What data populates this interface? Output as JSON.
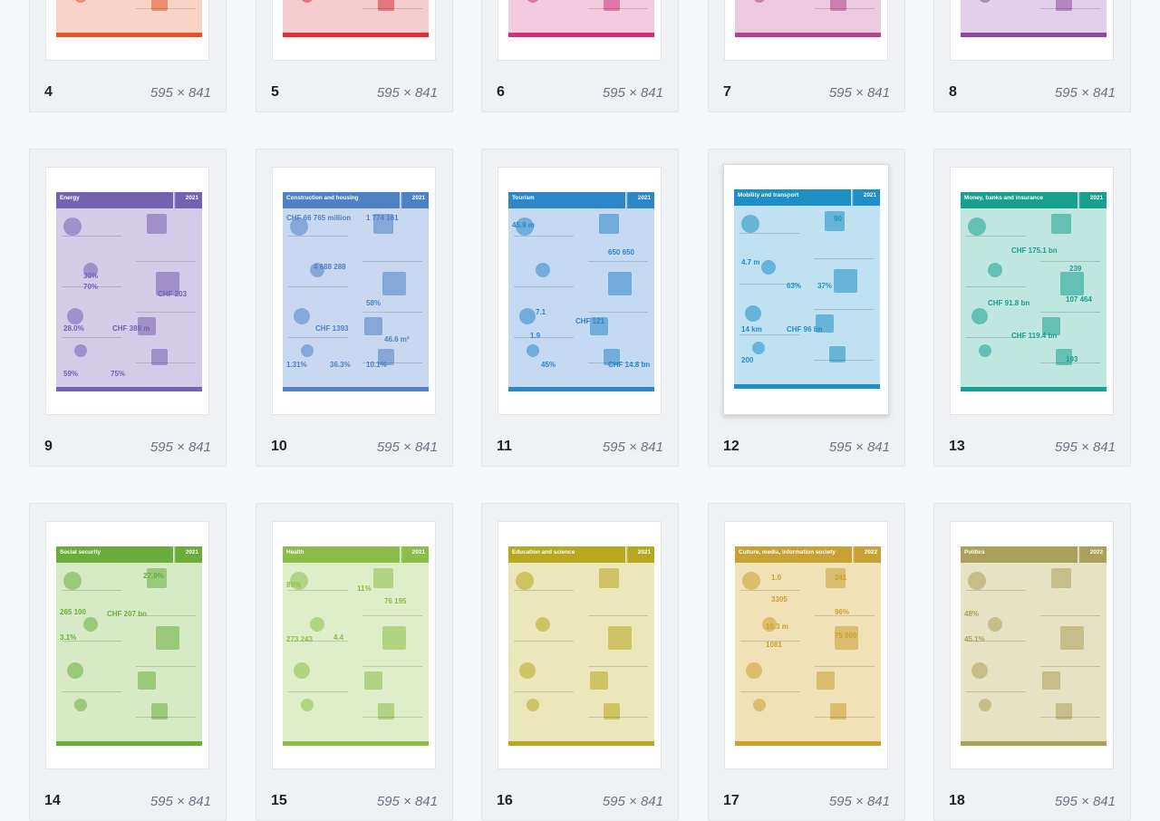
{
  "pages": [
    {
      "num": "4",
      "dims": "595 × 841",
      "theme": "#e4562a",
      "bg": "#f7d4c6",
      "title": "",
      "year": ""
    },
    {
      "num": "5",
      "dims": "595 × 841",
      "theme": "#dd2e3a",
      "bg": "#f4cdd0",
      "title": "",
      "year": ""
    },
    {
      "num": "6",
      "dims": "595 × 841",
      "theme": "#d0327a",
      "bg": "#f3cade",
      "title": "",
      "year": ""
    },
    {
      "num": "7",
      "dims": "595 × 841",
      "theme": "#b2448c",
      "bg": "#eccbe0",
      "title": "",
      "year": ""
    },
    {
      "num": "8",
      "dims": "595 × 841",
      "theme": "#8a4a9c",
      "bg": "#e2d0ea",
      "title": "",
      "year": ""
    },
    {
      "num": "9",
      "dims": "595 × 841",
      "theme": "#7461b0",
      "bg": "#d3cbe8",
      "title": "Energy",
      "year": "2021"
    },
    {
      "num": "10",
      "dims": "595 × 841",
      "theme": "#4f81c4",
      "bg": "#c7d8f0",
      "title": "Construction and housing",
      "year": "2021"
    },
    {
      "num": "11",
      "dims": "595 × 841",
      "theme": "#2d86c8",
      "bg": "#c3daf2",
      "title": "Tourism",
      "year": "2021"
    },
    {
      "num": "12",
      "dims": "595 × 841",
      "theme": "#1d8fc4",
      "bg": "#bfe1f1",
      "title": "Mobility and transport",
      "year": "2021"
    },
    {
      "num": "13",
      "dims": "595 × 841",
      "theme": "#17a08e",
      "bg": "#bfe6df",
      "title": "Money, banks and insurance",
      "year": "2021"
    },
    {
      "num": "14",
      "dims": "595 × 841",
      "theme": "#6aad3b",
      "bg": "#d6eac6",
      "title": "Social security",
      "year": "2021"
    },
    {
      "num": "15",
      "dims": "595 × 841",
      "theme": "#8cbd48",
      "bg": "#dfedc8",
      "title": "Health",
      "year": "2021"
    },
    {
      "num": "16",
      "dims": "595 × 841",
      "theme": "#b7a81f",
      "bg": "#ece6bb",
      "title": "Education and science",
      "year": "2021"
    },
    {
      "num": "17",
      "dims": "595 × 841",
      "theme": "#c9a032",
      "bg": "#f0e1b7",
      "title": "Culture, media, information society",
      "year": "2022"
    },
    {
      "num": "18",
      "dims": "595 × 841",
      "theme": "#a9a05a",
      "bg": "#e6e2c4",
      "title": "Politics",
      "year": "2022"
    }
  ],
  "energy": {
    "v1": "30%",
    "v2": "70%",
    "v3": "28.0%",
    "v4": "59%",
    "v5": "75%",
    "v6": "CHF 203",
    "v7": "CHF 389 m"
  },
  "construction": {
    "v1": "CHF 66 765 million",
    "v2": "1 774 161",
    "v3": "4 688 288",
    "v4": "58%",
    "v5": "CHF 1393",
    "v6": "46.6 m²",
    "v7": "1.31%",
    "v8": "36.3%",
    "v9": "10.1%"
  },
  "tourism": {
    "v1": "45.9 m",
    "v2": "650 650",
    "v3": "7.1",
    "v4": "1.9",
    "v5": "45%",
    "v6": "CHF 121",
    "v7": "CHF 14.8 bn"
  },
  "mobility": {
    "v1": "90",
    "v2": "4.7 m",
    "v3": "63%",
    "v4": "37%",
    "v5": "CHF 96 bn",
    "v6": "14 km",
    "v7": "200"
  },
  "money": {
    "v1": "CHF 175.1 bn",
    "v2": "239",
    "v3": "CHF 91.8 bn",
    "v4": "107 464",
    "v5": "CHF 119.4 bn",
    "v6": "193"
  },
  "social": {
    "v1": "27.9%",
    "v2": "265 100",
    "v3": "CHF 207 bn",
    "v4": "3.1%"
  },
  "health": {
    "v1": "85%",
    "v2": "11%",
    "v3": "76 195",
    "v4": "273 243",
    "v5": "4.4"
  },
  "culture": {
    "v1": "1.0",
    "v2": "241",
    "v3": "3305",
    "v4": "96%",
    "v5": "10.3 m",
    "v6": "75 000",
    "v7": "1081"
  },
  "politics": {
    "v1": "48%",
    "v2": "45.1%"
  }
}
